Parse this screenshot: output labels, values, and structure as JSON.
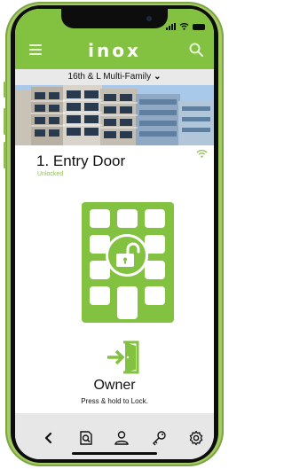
{
  "app": {
    "logo_text": "inox",
    "brand_color": "#83c241"
  },
  "header": {
    "menu_icon": "hamburger-menu-icon",
    "search_icon": "search-icon"
  },
  "property": {
    "name": "16th & L Multi-Family",
    "dropdown_icon": "chevron-down-icon"
  },
  "door": {
    "name": "1. Entry Door",
    "status": "Unlocked",
    "status_color": "#8bc34a",
    "connectivity_icon": "wifi-icon"
  },
  "keypad": {
    "lock_state_icon": "unlocked-padlock-icon"
  },
  "access": {
    "icon": "enter-door-icon",
    "role": "Owner",
    "instruction": "Press & hold to Lock."
  },
  "bottom_nav": {
    "items": [
      {
        "icon": "back-chevron-icon"
      },
      {
        "icon": "search-log-icon"
      },
      {
        "icon": "user-icon"
      },
      {
        "icon": "key-icon"
      },
      {
        "icon": "settings-gear-icon"
      }
    ]
  }
}
